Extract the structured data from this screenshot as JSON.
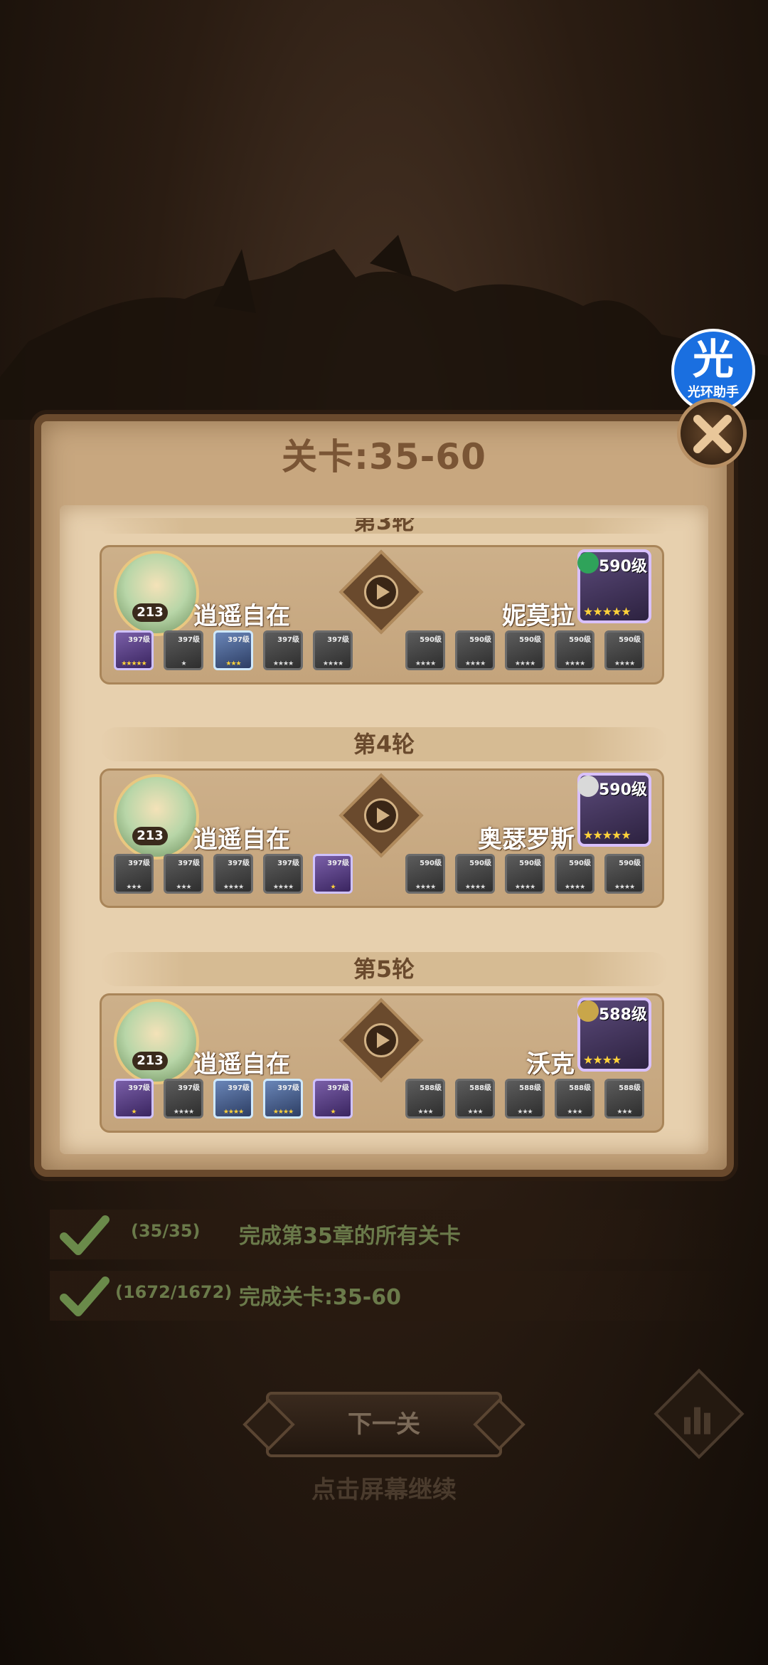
{
  "badge": {
    "char": "光",
    "label": "光环助手"
  },
  "title": "关卡:35-60",
  "rounds": [
    {
      "label": "第3轮",
      "player": {
        "level": "213",
        "name": "逍遥自在",
        "slots": [
          {
            "level": "397级",
            "stars": "★★★★★",
            "kind": "hero"
          },
          {
            "level": "397级",
            "stars": "★",
            "kind": "dim"
          },
          {
            "level": "397级",
            "stars": "★★★",
            "kind": "hero2"
          },
          {
            "level": "397级",
            "stars": "★★★★",
            "kind": "dim"
          },
          {
            "level": "397级",
            "stars": "★★★★",
            "kind": "dim"
          }
        ]
      },
      "enemy": {
        "level": "590级",
        "stars": "★★★★★",
        "name": "妮莫拉",
        "slots": [
          {
            "level": "590级",
            "stars": "★★★★"
          },
          {
            "level": "590级",
            "stars": "★★★★"
          },
          {
            "level": "590级",
            "stars": "★★★★"
          },
          {
            "level": "590级",
            "stars": "★★★★"
          },
          {
            "level": "590级",
            "stars": "★★★★"
          }
        ]
      }
    },
    {
      "label": "第4轮",
      "player": {
        "level": "213",
        "name": "逍遥自在",
        "slots": [
          {
            "level": "397级",
            "stars": "★★★",
            "kind": "dim"
          },
          {
            "level": "397级",
            "stars": "★★★",
            "kind": "dim"
          },
          {
            "level": "397级",
            "stars": "★★★★",
            "kind": "dim"
          },
          {
            "level": "397级",
            "stars": "★★★★",
            "kind": "dim"
          },
          {
            "level": "397级",
            "stars": "★",
            "kind": "hero"
          }
        ]
      },
      "enemy": {
        "level": "590级",
        "stars": "★★★★★",
        "name": "奥瑟罗斯",
        "slots": [
          {
            "level": "590级",
            "stars": "★★★★"
          },
          {
            "level": "590级",
            "stars": "★★★★"
          },
          {
            "level": "590级",
            "stars": "★★★★"
          },
          {
            "level": "590级",
            "stars": "★★★★"
          },
          {
            "level": "590级",
            "stars": "★★★★"
          }
        ]
      }
    },
    {
      "label": "第5轮",
      "player": {
        "level": "213",
        "name": "逍遥自在",
        "slots": [
          {
            "level": "397级",
            "stars": "★",
            "kind": "hero"
          },
          {
            "level": "397级",
            "stars": "★★★★",
            "kind": "dim"
          },
          {
            "level": "397级",
            "stars": "★★★★",
            "kind": "hero2"
          },
          {
            "level": "397级",
            "stars": "★★★★",
            "kind": "hero2"
          },
          {
            "level": "397级",
            "stars": "★",
            "kind": "hero"
          }
        ]
      },
      "enemy": {
        "level": "588级",
        "stars": "★★★★",
        "name": "沃克",
        "slots": [
          {
            "level": "588级",
            "stars": "★★★"
          },
          {
            "level": "588级",
            "stars": "★★★"
          },
          {
            "level": "588级",
            "stars": "★★★"
          },
          {
            "level": "588级",
            "stars": "★★★"
          },
          {
            "level": "588级",
            "stars": "★★★"
          }
        ]
      }
    }
  ],
  "tasks": [
    {
      "progress": "(35/35)",
      "text": "完成第35章的所有关卡"
    },
    {
      "progress": "(1672/1672)",
      "text": "完成关卡:35-60"
    }
  ],
  "next_button": "下一关",
  "hint": "点击屏幕继续",
  "colors": {
    "accent": "#7a5535",
    "task_text": "#6a7a4a",
    "badge_blue": "#1a6fe0"
  }
}
